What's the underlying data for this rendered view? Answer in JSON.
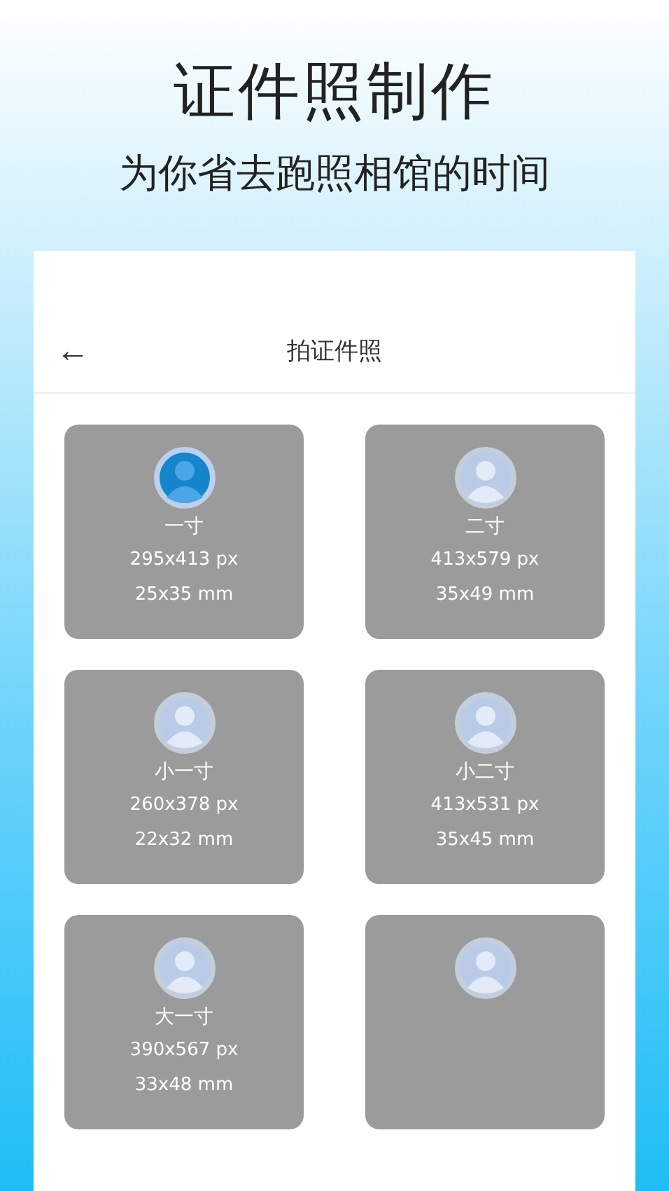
{
  "headline": "证件照制作",
  "subheadline": "为你省去跑照相馆的时间",
  "screen": {
    "title": "拍证件照",
    "back": "←"
  },
  "sizes": [
    {
      "name": "一寸",
      "pixels": "295x413 px",
      "mm": "25x35 mm",
      "selected": true
    },
    {
      "name": "二寸",
      "pixels": "413x579 px",
      "mm": "35x49 mm",
      "selected": false
    },
    {
      "name": "小一寸",
      "pixels": "260x378 px",
      "mm": "22x32 mm",
      "selected": false
    },
    {
      "name": "小二寸",
      "pixels": "413x531 px",
      "mm": "35x45 mm",
      "selected": false
    },
    {
      "name": "大一寸",
      "pixels": "390x567 px",
      "mm": "33x48 mm",
      "selected": false
    },
    {
      "selected": false
    }
  ]
}
